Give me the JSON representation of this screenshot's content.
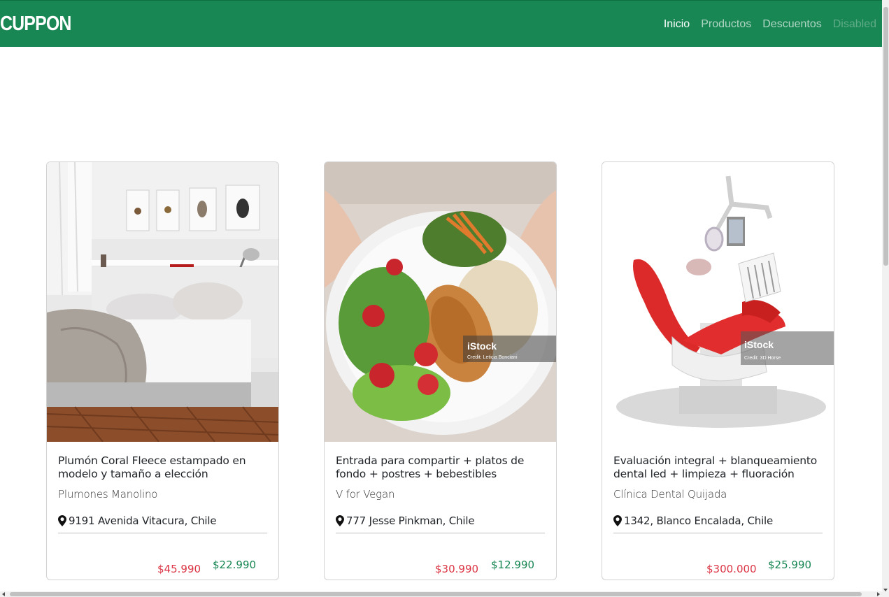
{
  "navbar": {
    "brand": "CUPPON",
    "links": [
      {
        "label": "Inicio",
        "state": "active"
      },
      {
        "label": "Productos",
        "state": "normal"
      },
      {
        "label": "Descuentos",
        "state": "normal"
      },
      {
        "label": "Disabled",
        "state": "disabled"
      }
    ],
    "color": "#198754"
  },
  "cards": [
    {
      "title": "Plumón Coral Fleece estampado en modelo y tamaño a elección",
      "vendor": "Plumones Manolino",
      "address": "9191 Avenida Vitacura, Chile",
      "price_old": "$45.990",
      "price_new": "$22.990",
      "image": "bedroom-photo"
    },
    {
      "title": "Entrada para compartir + platos de fondo + postres + bebestibles",
      "vendor": "V for Vegan",
      "address": "777 Jesse Pinkman, Chile",
      "price_old": "$30.990",
      "price_new": "$12.990",
      "image": "salad-plate-photo",
      "watermark_brand": "iStock",
      "watermark_credit": "Credit: Leticia Bonciani"
    },
    {
      "title": "Evaluación integral + blanqueamiento dental led + limpieza + fluoración",
      "vendor": "Clínica Dental Quijada",
      "address": "1342, Blanco Encalada, Chile",
      "price_old": "$300.000",
      "price_new": "$25.990",
      "image": "dental-chair-photo",
      "watermark_brand": "iStock",
      "watermark_credit": "Credit: 3D Horse"
    }
  ],
  "colors": {
    "price_old": "#dc3545",
    "price_new": "#198754"
  }
}
